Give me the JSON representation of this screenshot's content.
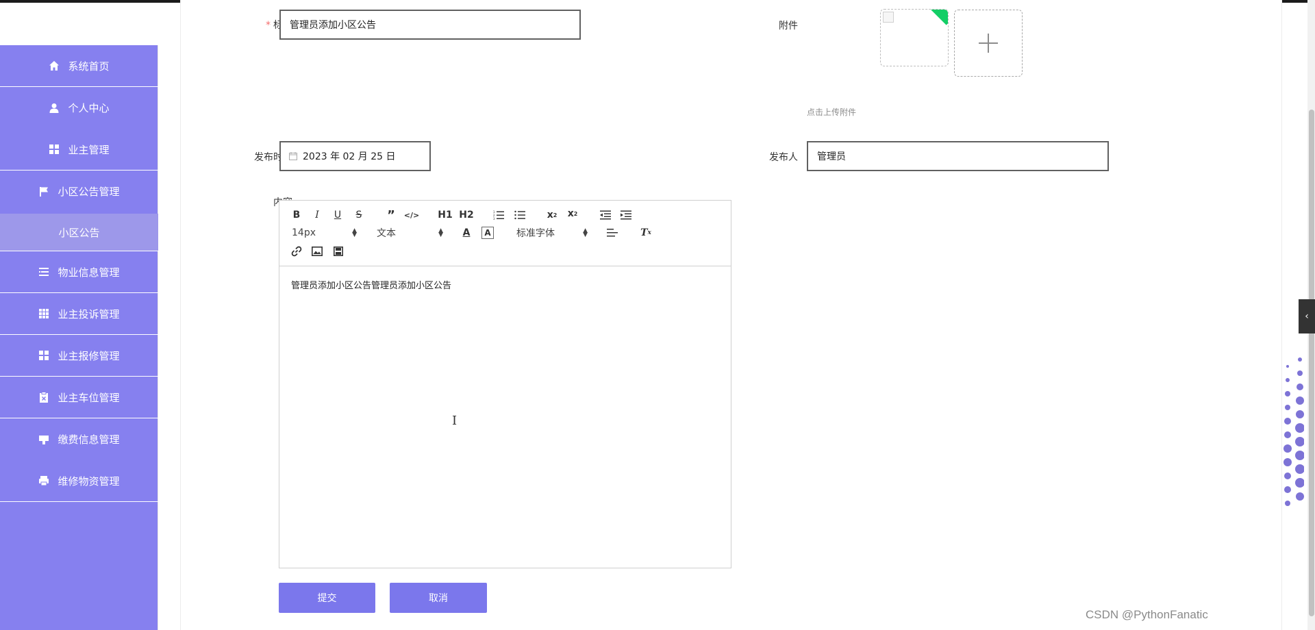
{
  "sidebar": {
    "items": [
      {
        "label": "系统首页",
        "icon": "home-icon"
      },
      {
        "label": "个人中心",
        "icon": "user-icon"
      },
      {
        "label": "业主管理",
        "icon": "grid-icon"
      },
      {
        "label": "小区公告管理",
        "icon": "flag-icon"
      },
      {
        "label": "小区公告",
        "icon": ""
      },
      {
        "label": "物业信息管理",
        "icon": "list-icon"
      },
      {
        "label": "业主投诉管理",
        "icon": "table-icon"
      },
      {
        "label": "业主报修管理",
        "icon": "grid-icon"
      },
      {
        "label": "业主车位管理",
        "icon": "clipboard-icon"
      },
      {
        "label": "缴费信息管理",
        "icon": "sign-icon"
      },
      {
        "label": "维修物资管理",
        "icon": "printer-icon"
      }
    ]
  },
  "form": {
    "title_label": "标题",
    "title_value": "管理员添加小区公告",
    "attachment_label": "附件",
    "upload_hint": "点击上传附件",
    "publish_time_label": "发布时间",
    "publish_time_value": "2023 年 02 月 25 日",
    "publisher_label": "发布人",
    "publisher_value": "管理员",
    "content_label": "内容"
  },
  "editor": {
    "toolbar": {
      "font_size": "14px",
      "header_format": "文本",
      "font_family": "标准字体",
      "h1_label": "H1",
      "h2_label": "H2"
    },
    "content": "管理员添加小区公告管理员添加小区公告"
  },
  "buttons": {
    "submit": "提交",
    "cancel": "取消"
  },
  "watermark": "CSDN @PythonFanatic",
  "colors": {
    "sidebar": "#8680ef",
    "button": "#7b77ec",
    "required": "#f56c6c"
  }
}
